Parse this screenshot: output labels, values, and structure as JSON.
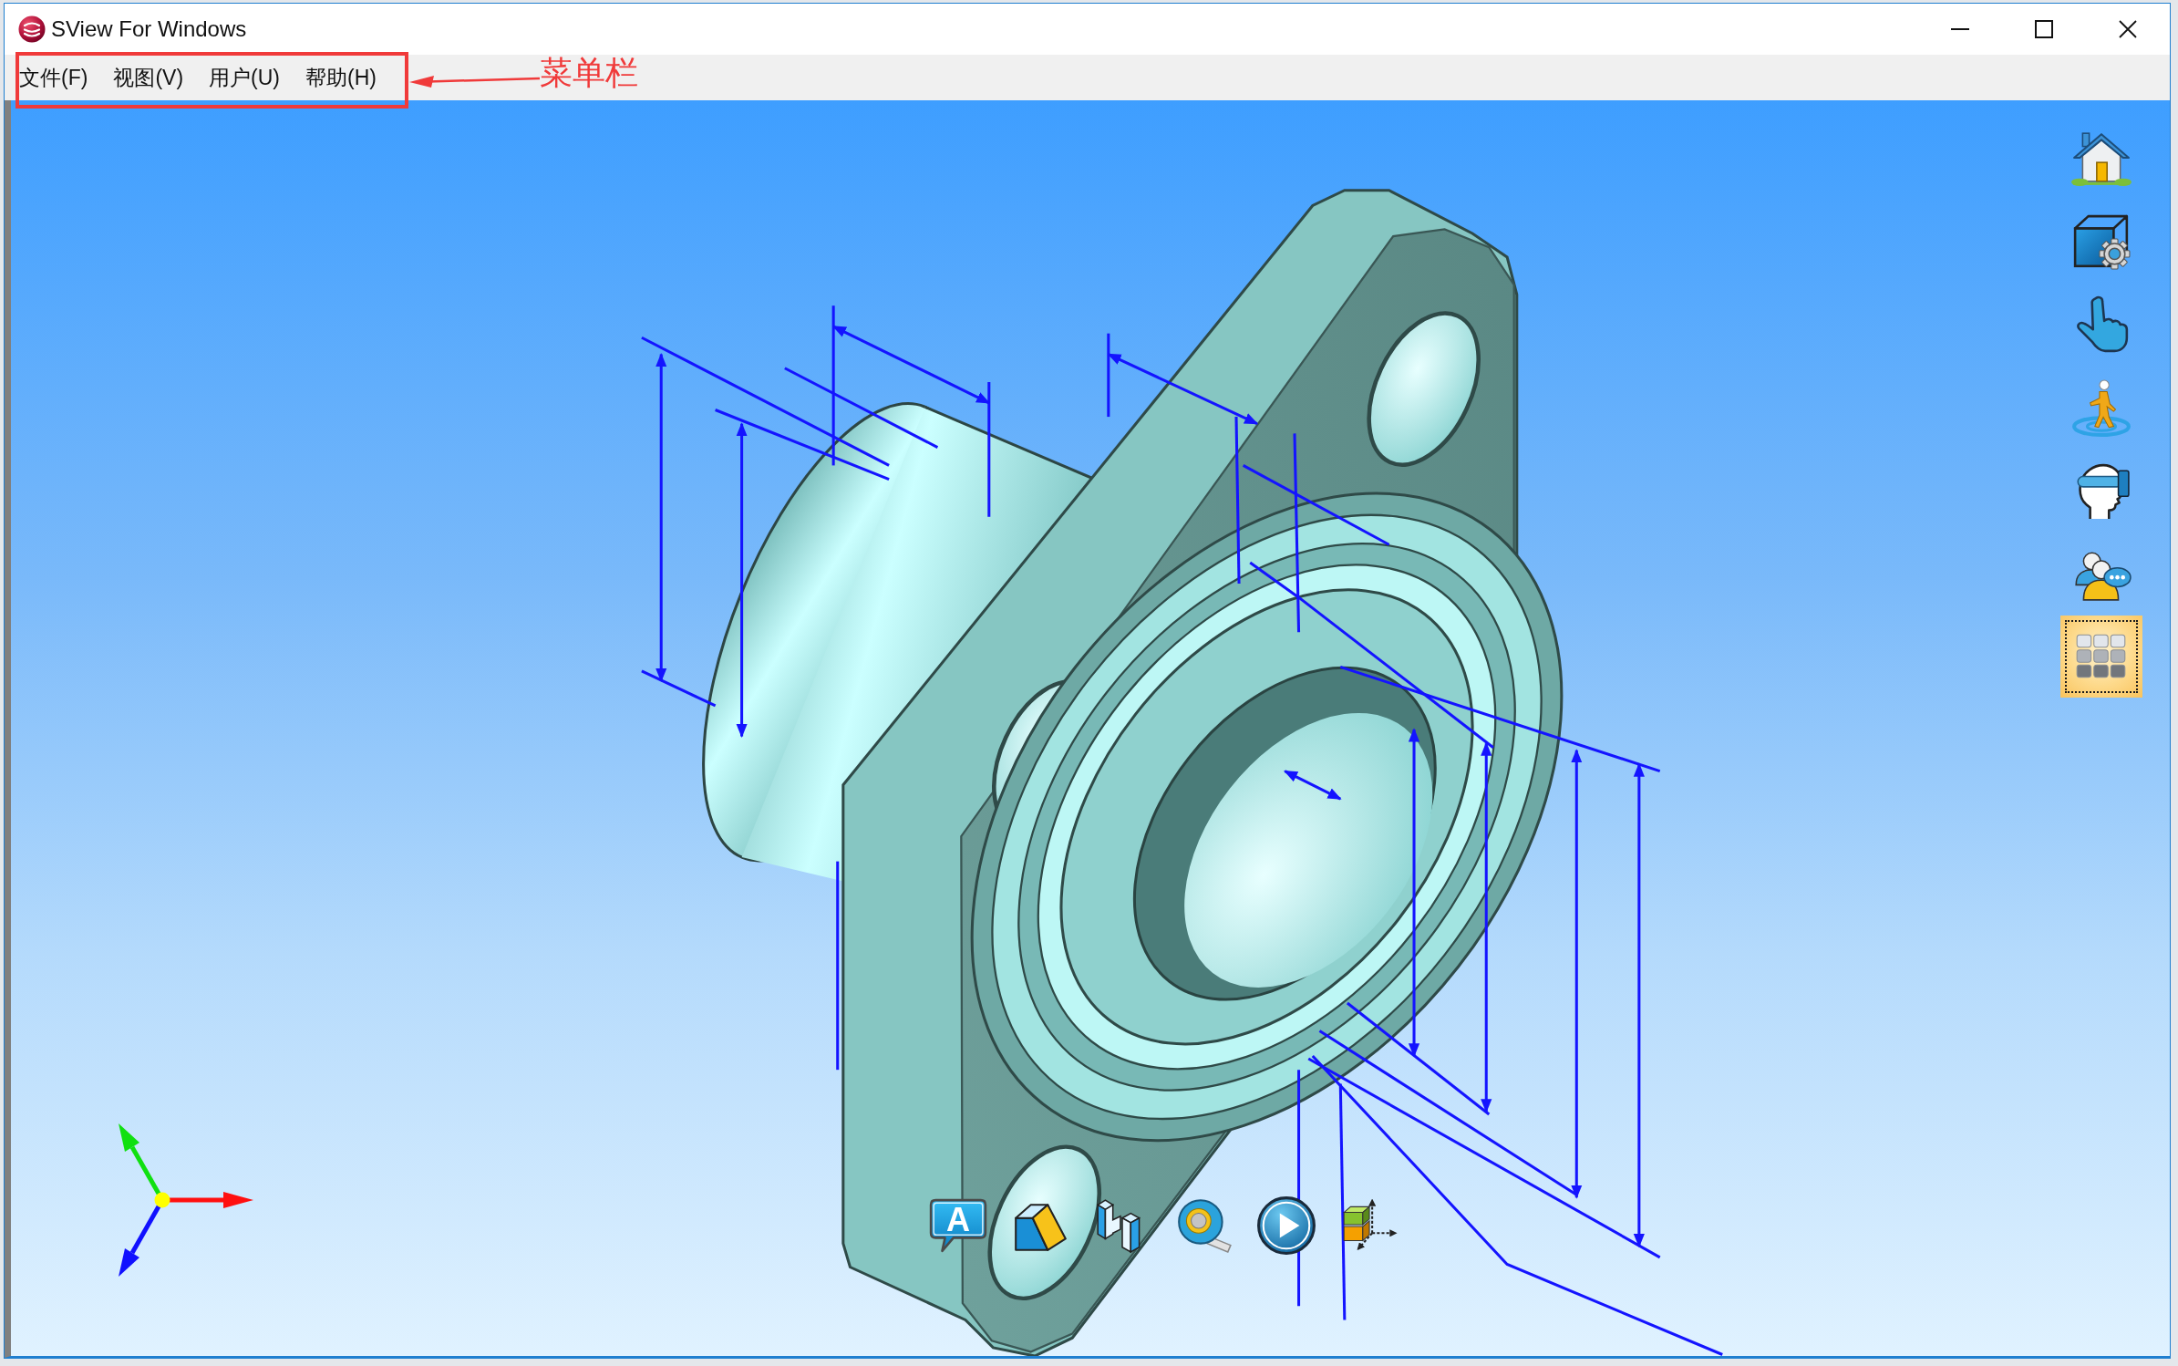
{
  "window": {
    "title": "SView For Windows"
  },
  "menu_bar": {
    "items": [
      {
        "label": "文件(F)"
      },
      {
        "label": "视图(V)"
      },
      {
        "label": "用户(U)"
      },
      {
        "label": "帮助(H)"
      }
    ]
  },
  "callout": {
    "label": "菜单栏"
  },
  "right_toolbar": {
    "tools": [
      {
        "kind": "home",
        "selected": false
      },
      {
        "kind": "cube",
        "selected": false
      },
      {
        "kind": "hand",
        "selected": false
      },
      {
        "kind": "walker",
        "selected": false
      },
      {
        "kind": "headset",
        "selected": false
      },
      {
        "kind": "people",
        "selected": false
      },
      {
        "kind": "grid",
        "selected": true
      }
    ]
  },
  "bottom_toolbar": {
    "tools": [
      {
        "kind": "note",
        "label": "A"
      },
      {
        "kind": "wedge"
      },
      {
        "kind": "blocks"
      },
      {
        "kind": "tape"
      },
      {
        "kind": "play"
      },
      {
        "kind": "axes"
      }
    ]
  }
}
